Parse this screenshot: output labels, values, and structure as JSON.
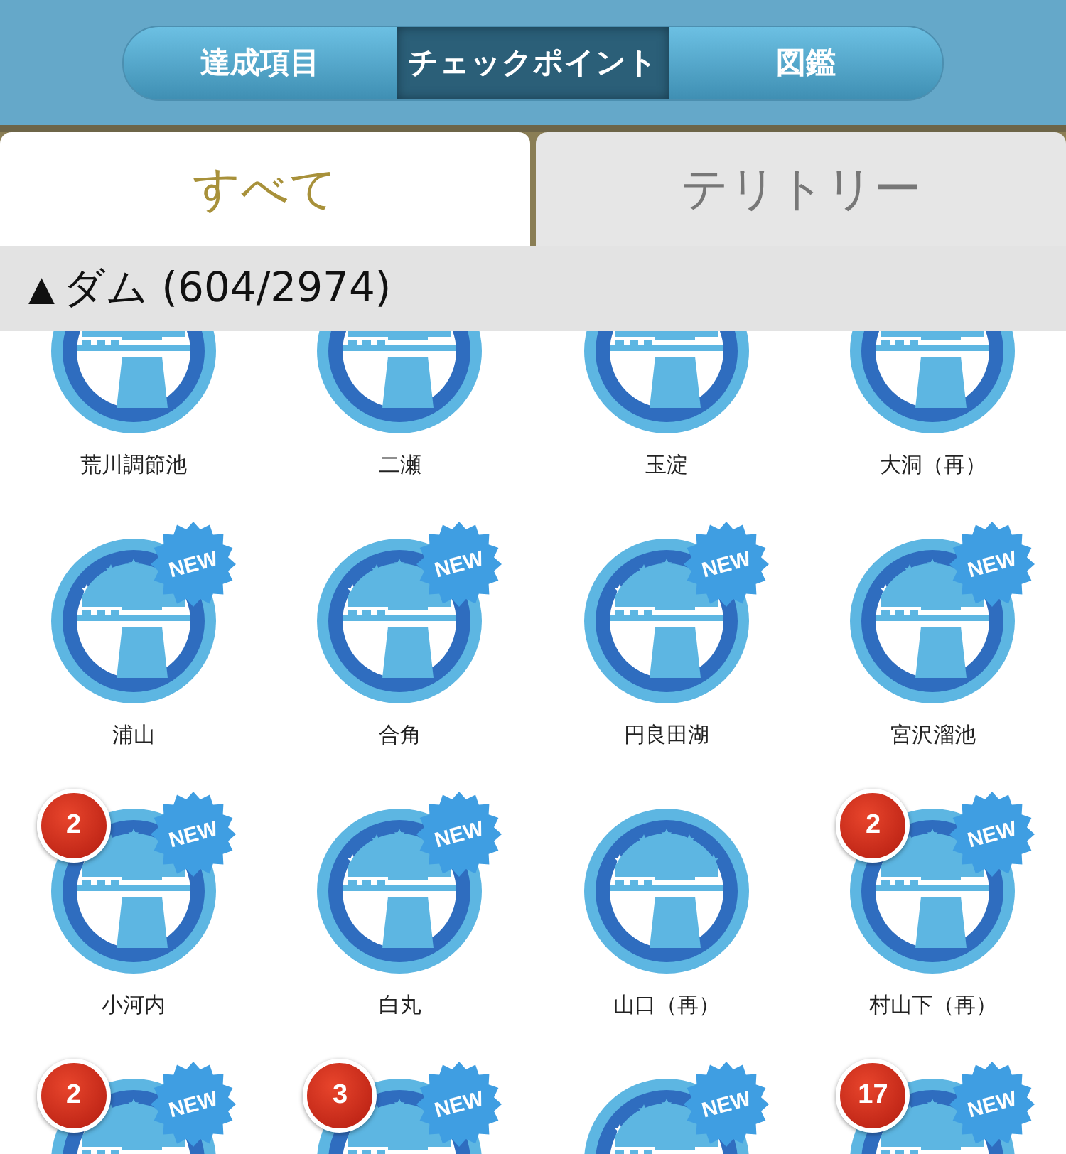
{
  "segments": [
    {
      "label": "達成項目",
      "selected": false
    },
    {
      "label": "チェックポイント",
      "selected": true
    },
    {
      "label": "図鑑",
      "selected": false
    }
  ],
  "tabs": [
    {
      "label": "すべて",
      "selected": true
    },
    {
      "label": "テリトリー",
      "selected": false
    }
  ],
  "section": {
    "arrow": "▲",
    "title": "ダム (604/2974)"
  },
  "items": [
    {
      "name": "荒川調節池"
    },
    {
      "name": "二瀬"
    },
    {
      "name": "玉淀"
    },
    {
      "name": "大洞（再）"
    },
    {
      "name": "浦山",
      "new_badge": "NEW"
    },
    {
      "name": "合角",
      "new_badge": "NEW"
    },
    {
      "name": "円良田湖",
      "new_badge": "NEW"
    },
    {
      "name": "宮沢溜池",
      "new_badge": "NEW"
    },
    {
      "name": "小河内",
      "new_badge": "NEW",
      "count": "2"
    },
    {
      "name": "白丸",
      "new_badge": "NEW"
    },
    {
      "name": "山口（再）"
    },
    {
      "name": "村山下（再）",
      "new_badge": "NEW",
      "count": "2"
    },
    {
      "new_badge": "NEW",
      "count": "2"
    },
    {
      "new_badge": "NEW",
      "count": "3"
    },
    {
      "new_badge": "NEW"
    },
    {
      "new_badge": "NEW",
      "count": "17"
    }
  ]
}
